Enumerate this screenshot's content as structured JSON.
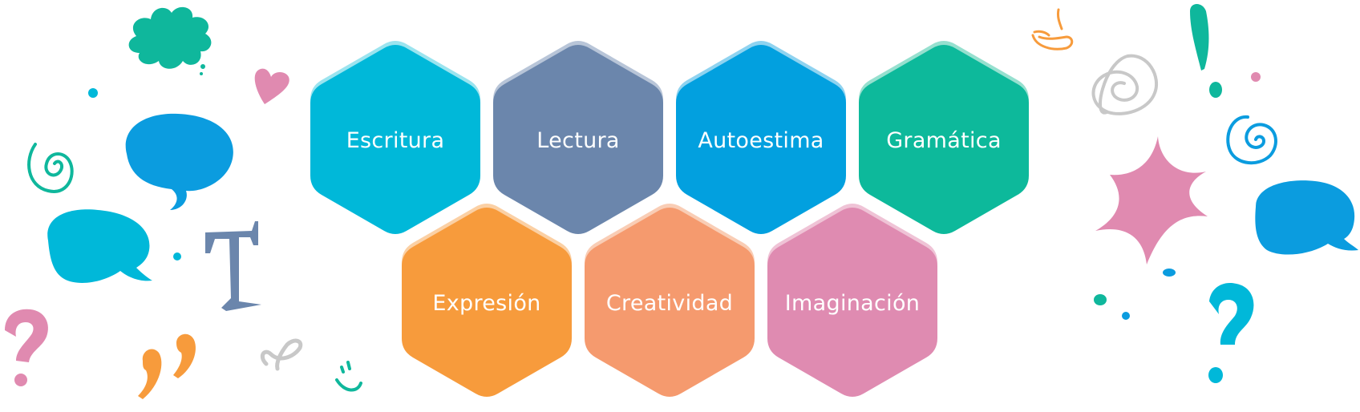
{
  "hexagons": [
    {
      "label": "Escritura",
      "color": "#00B8D9",
      "edge": "#9BE4EF"
    },
    {
      "label": "Lectura",
      "color": "#6B86AC",
      "edge": "#B8C5D8"
    },
    {
      "label": "Autoestima",
      "color": "#02A0DF",
      "edge": "#8FD3F0"
    },
    {
      "label": "Gramática",
      "color": "#0DB99B",
      "edge": "#96E0CF"
    },
    {
      "label": "Expresión",
      "color": "#F79B3C",
      "edge": "#FBD0A4"
    },
    {
      "label": "Creatividad",
      "color": "#F59A6E",
      "edge": "#F9CDB5"
    },
    {
      "label": "Imaginación",
      "color": "#DF8BB1",
      "edge": "#EFC3D6"
    }
  ],
  "decorations": {
    "pink": "#E08AB0",
    "teal": "#0FB79C",
    "cyan": "#00B8D9",
    "blue": "#0B9CDF",
    "orange": "#F79B3C",
    "slate": "#6B86AC",
    "gray": "#C8C8C8"
  }
}
